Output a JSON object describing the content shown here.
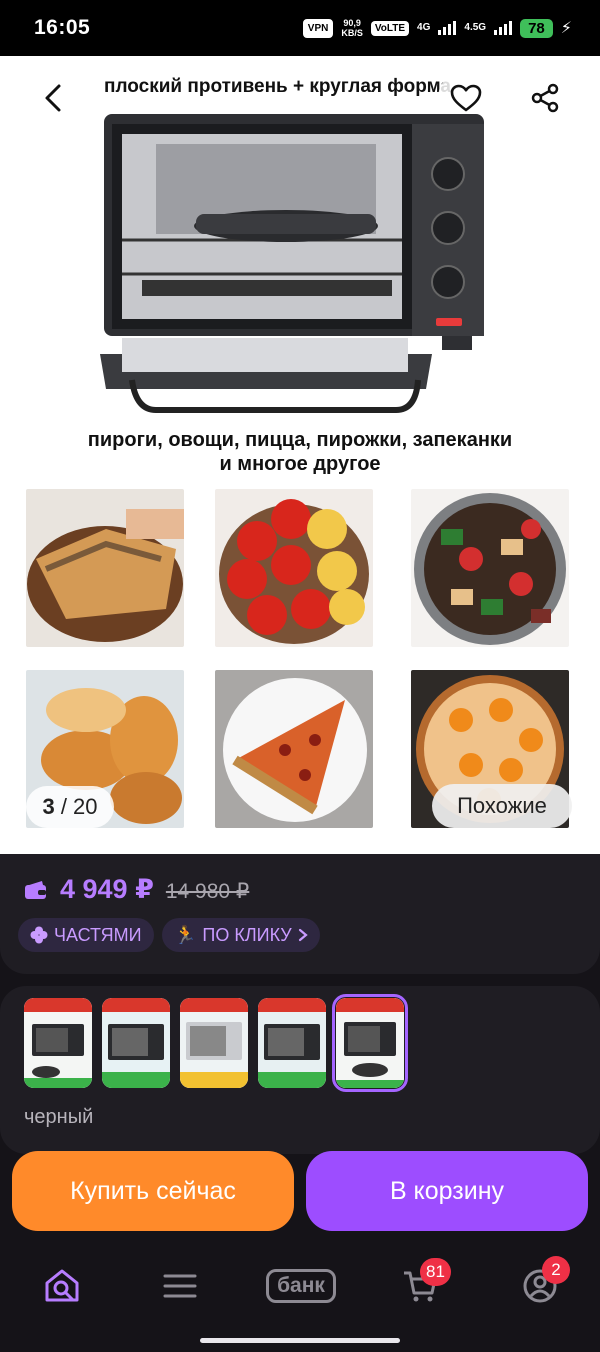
{
  "status_bar": {
    "time": "16:05",
    "vpn": "VPN",
    "speed_value": "90,9",
    "speed_unit": "KB/S",
    "volte": "VoLTE",
    "network_1": "4G",
    "network_2": "4.5G",
    "battery": "78"
  },
  "gallery": {
    "caption_top": "плоский противень + круглая форма",
    "caption_mid": "пироги, овощи, пицца, пирожки, запеканки",
    "caption_mid_2": "и многое другое",
    "counter_current": "3",
    "counter_total": "/ 20",
    "similar_label": "Похожие"
  },
  "price": {
    "current": "4 949 ₽",
    "old": "14 980 ₽",
    "badge_parts": "ЧАСТЯМИ",
    "badge_click": "ПО КЛИКУ"
  },
  "variants": {
    "selected_color": "черный",
    "count": 5,
    "selected_index": 4
  },
  "actions": {
    "buy_now": "Купить сейчас",
    "add_to_cart": "В корзину"
  },
  "bottom_nav": {
    "bank_label": "банк",
    "cart_badge": "81",
    "profile_badge": "2"
  },
  "colors": {
    "accent": "#9d4dff",
    "price": "#b77dff",
    "buy": "#ff8a2a",
    "badge": "#ef3046"
  }
}
